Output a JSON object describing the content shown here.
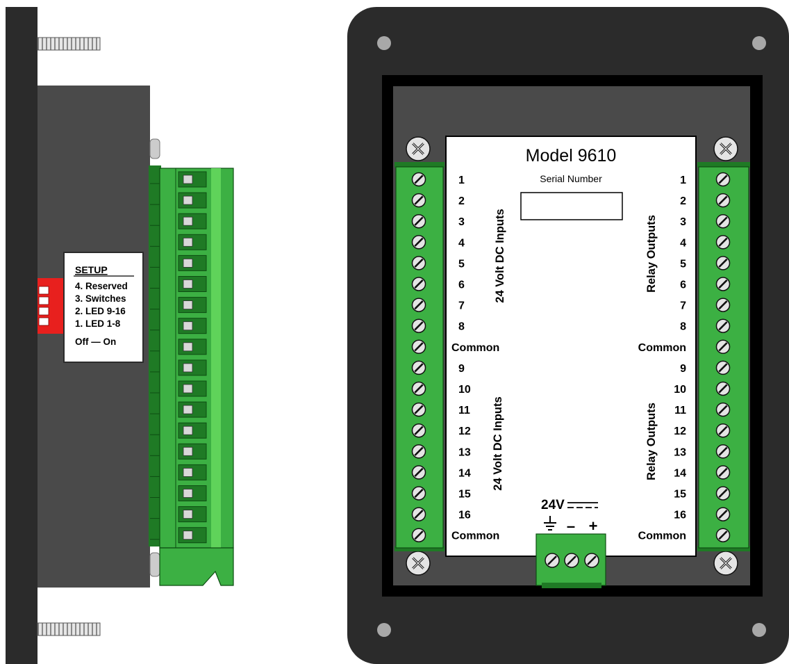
{
  "colors": {
    "panel_dark": "#2b2b2b",
    "housing_gray": "#4a4a4a",
    "terminal_green": "#3cb043",
    "terminal_green_light": "#5fd35a",
    "terminal_green_dark": "#1f7a25",
    "dip_red": "#e8201e",
    "label_white": "#ffffff"
  },
  "setup_label": {
    "title": "SETUP",
    "items": [
      "4. Reserved",
      "3. Switches",
      "2. LED 9-16",
      "1. LED 1-8"
    ],
    "off_on": "Off — On"
  },
  "front_label": {
    "model": "Model 9610",
    "serial_label": "Serial Number",
    "left_group_1": "24 Volt DC Inputs",
    "left_group_2": "24 Volt DC Inputs",
    "right_group_1": "Relay Outputs",
    "right_group_2": "Relay Outputs",
    "terminals": [
      "1",
      "2",
      "3",
      "4",
      "5",
      "6",
      "7",
      "8",
      "Common",
      "9",
      "10",
      "11",
      "12",
      "13",
      "14",
      "15",
      "16",
      "Common"
    ],
    "power_label": "24V",
    "power_minus": "–",
    "power_plus": "+"
  }
}
